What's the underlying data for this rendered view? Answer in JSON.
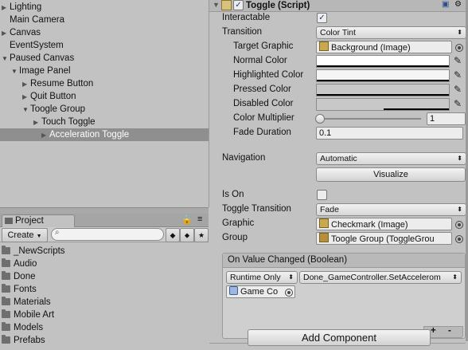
{
  "hierarchy": {
    "items": [
      {
        "label": "Lighting"
      },
      {
        "label": "Main Camera"
      },
      {
        "label": "Canvas"
      },
      {
        "label": "EventSystem"
      },
      {
        "label": "Paused Canvas"
      },
      {
        "label": "Image Panel"
      },
      {
        "label": "Resume Button"
      },
      {
        "label": "Quit Button"
      },
      {
        "label": "Toogle Group"
      },
      {
        "label": "Touch Toggle"
      },
      {
        "label": "Acceleration Toggle"
      }
    ]
  },
  "project": {
    "tab_label": "Project",
    "create_label": "Create",
    "folders": [
      "_NewScripts",
      "Audio",
      "Done",
      "Fonts",
      "Materials",
      "Mobile Art",
      "Models",
      "Prefabs"
    ]
  },
  "inspector": {
    "component_title": "Toggle (Script)",
    "interactable_label": "Interactable",
    "transition_label": "Transition",
    "transition_value": "Color Tint",
    "target_graphic_label": "Target Graphic",
    "target_graphic_value": "Background (Image)",
    "normal_color_label": "Normal Color",
    "highlighted_color_label": "Highlighted Color",
    "pressed_color_label": "Pressed Color",
    "disabled_color_label": "Disabled Color",
    "color_multiplier_label": "Color Multiplier",
    "color_multiplier_value": "1",
    "fade_duration_label": "Fade Duration",
    "fade_duration_value": "0.1",
    "navigation_label": "Navigation",
    "navigation_value": "Automatic",
    "visualize_label": "Visualize",
    "is_on_label": "Is On",
    "toggle_transition_label": "Toggle Transition",
    "toggle_transition_value": "Fade",
    "graphic_label": "Graphic",
    "graphic_value": "Checkmark (Image)",
    "group_label": "Group",
    "group_value": "Toogle Group (ToggleGrou",
    "event_header": "On Value Changed (Boolean)",
    "runtime_value": "Runtime Only",
    "function_value": "Done_GameController.SetAccelerom",
    "object_value": "Game Co",
    "add_component_label": "Add Component",
    "plus_label": "+",
    "minus_label": "-"
  }
}
